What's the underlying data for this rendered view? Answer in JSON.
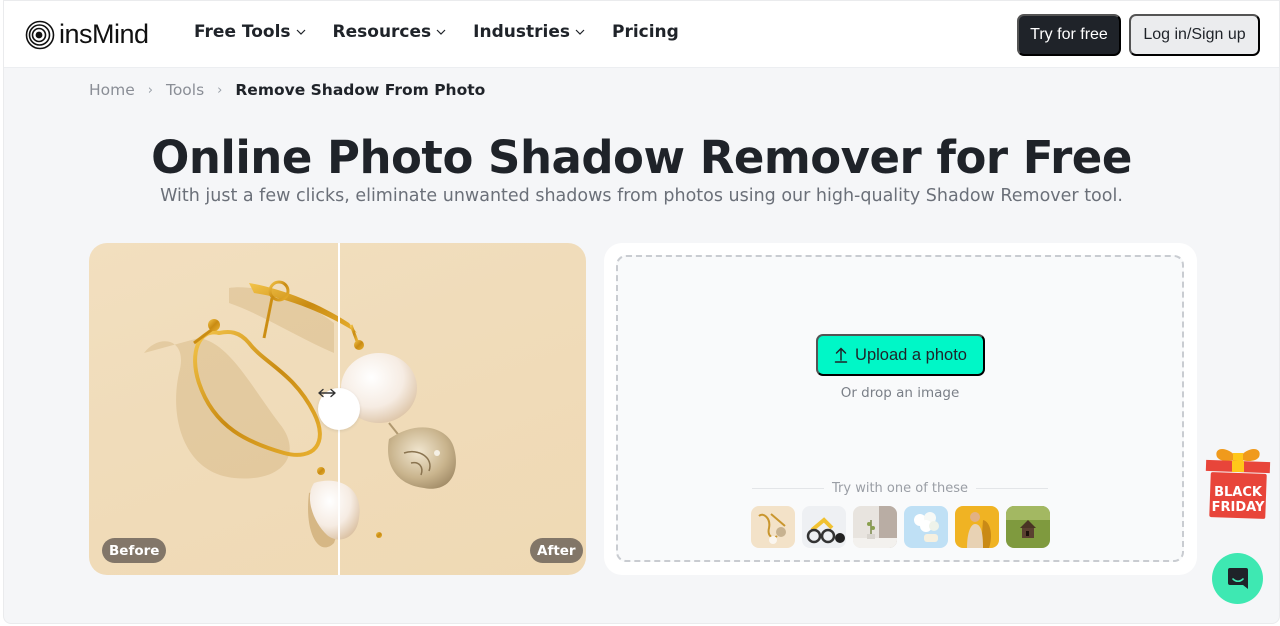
{
  "brand": {
    "name": "insMind",
    "logo_icon": "concentric-rings-logo"
  },
  "nav": {
    "items": [
      {
        "label": "Free Tools",
        "has_dropdown": true
      },
      {
        "label": "Resources",
        "has_dropdown": true
      },
      {
        "label": "Industries",
        "has_dropdown": true
      },
      {
        "label": "Pricing",
        "has_dropdown": false
      }
    ],
    "try_free_label": "Try for free",
    "login_label": "Log in/Sign up"
  },
  "breadcrumb": {
    "items": [
      "Home",
      "Tools"
    ],
    "current": "Remove Shadow From Photo",
    "separator": "›"
  },
  "hero": {
    "title": "Online Photo Shadow Remover for Free",
    "subtitle": "With just a few clicks, eliminate unwanted shadows from photos using our high-quality Shadow Remover tool."
  },
  "compare": {
    "before_label": "Before",
    "after_label": "After",
    "handle_icon": "left-right-arrow-icon",
    "slider_position": 0.5
  },
  "upload": {
    "button_label": "Upload a photo",
    "button_icon": "upload-arrow-icon",
    "drop_hint": "Or drop an image",
    "samples_label": "Try with one of these",
    "samples": [
      {
        "name": "earrings"
      },
      {
        "name": "balance-bike"
      },
      {
        "name": "plant-corner"
      },
      {
        "name": "white-flowers"
      },
      {
        "name": "woman-yellow"
      },
      {
        "name": "birdhouse-grass"
      }
    ]
  },
  "promo": {
    "line1": "BLACK",
    "line2": "FRIDAY"
  },
  "colors": {
    "accent": "#00f7c7",
    "primary_dark": "#1f2329",
    "chat": "#3ee8b2",
    "promo_red": "#e8453a"
  }
}
